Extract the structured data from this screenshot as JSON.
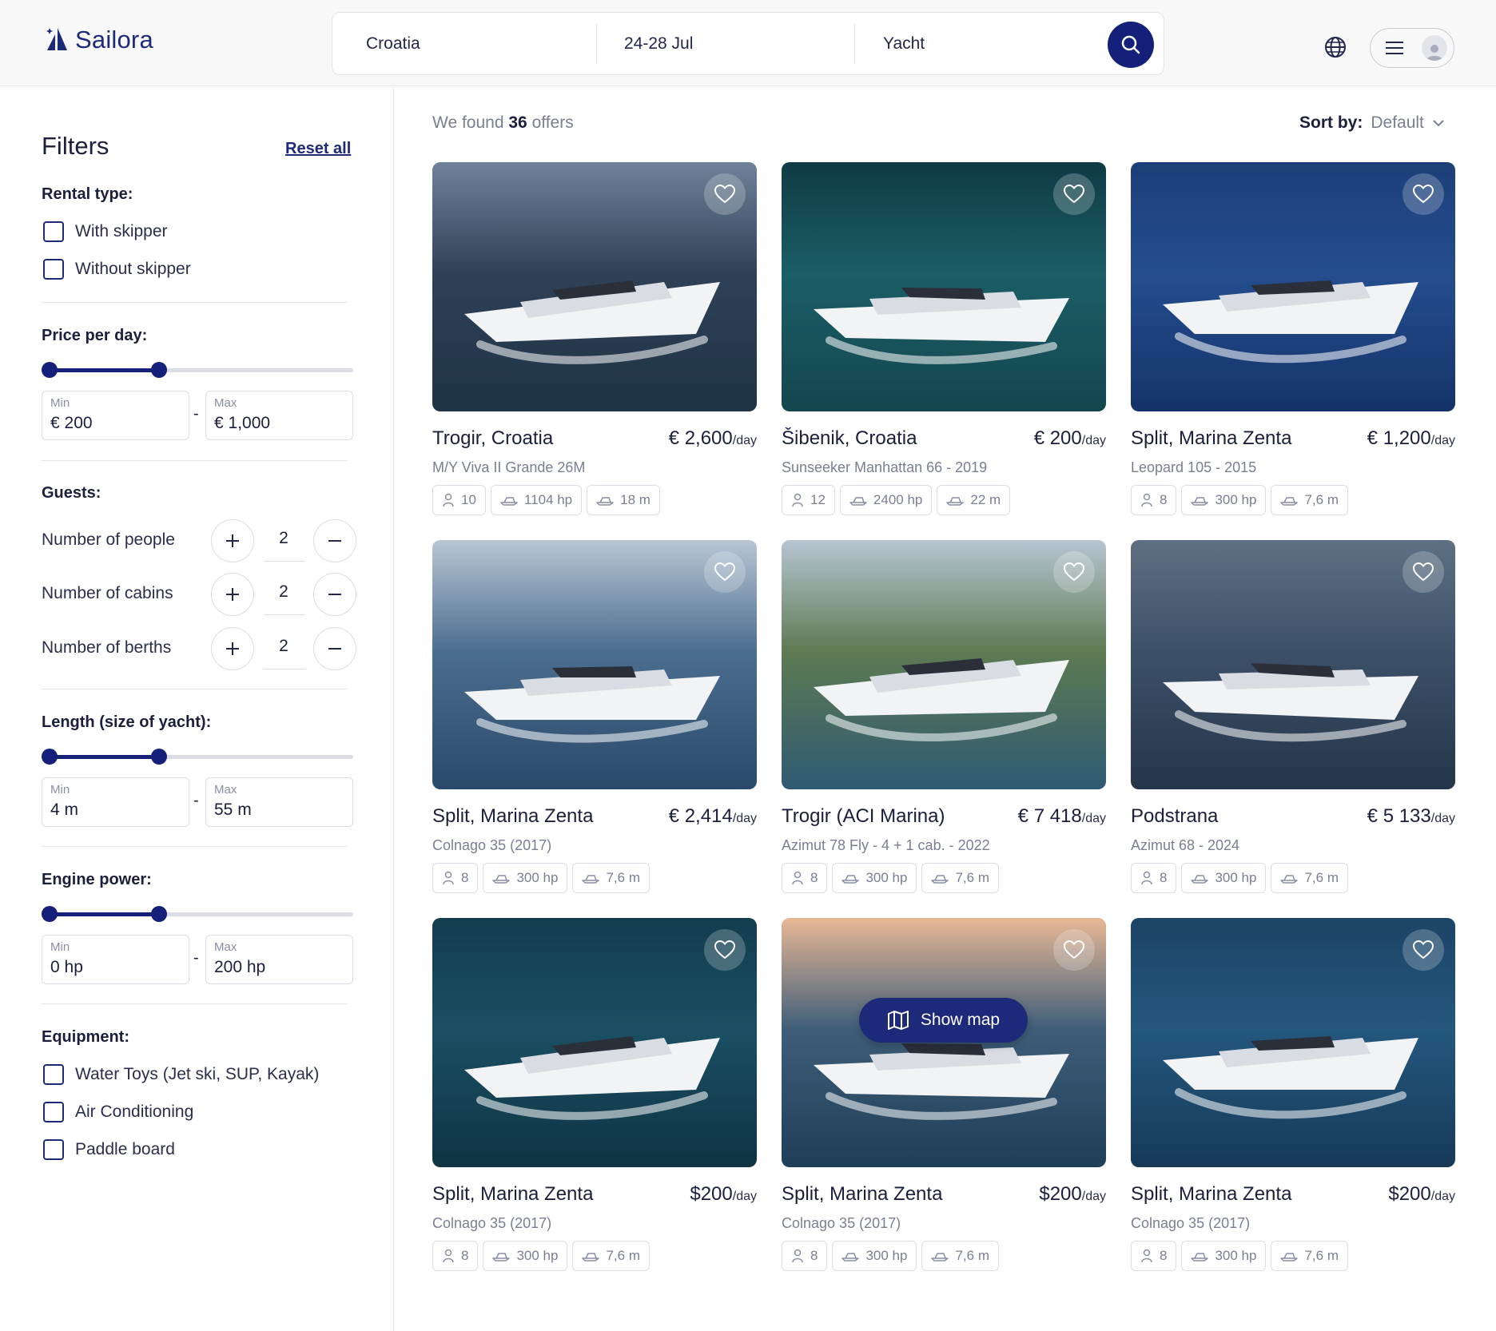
{
  "brand": {
    "name": "Sailora",
    "color": "#1d2a7a"
  },
  "search": {
    "location": "Croatia",
    "dates": "24-28 Jul",
    "boat_type": "Yacht",
    "button_icon": "search-icon"
  },
  "header": {
    "globe_icon": "globe-icon",
    "menu_icon": "hamburger-icon",
    "avatar_icon": "user-icon"
  },
  "filters": {
    "title": "Filters",
    "reset_label": "Reset all",
    "rental_type": {
      "label": "Rental type:",
      "options": [
        "With skipper",
        "Without skipper"
      ]
    },
    "price": {
      "label": "Price per day:",
      "min_label": "Min",
      "min_value": "€ 200",
      "max_label": "Max",
      "max_value": "€ 1,000",
      "range_fraction": [
        0,
        0.36
      ]
    },
    "guests": {
      "label": "Guests:",
      "rows": [
        {
          "label": "Number of people",
          "value": "2"
        },
        {
          "label": "Number of cabins",
          "value": "2"
        },
        {
          "label": "Number of berths",
          "value": "2"
        }
      ]
    },
    "length": {
      "label": "Length (size of yacht):",
      "min_label": "Min",
      "min_value": "4 m",
      "max_label": "Max",
      "max_value": "55 m",
      "range_fraction": [
        0,
        0.36
      ]
    },
    "engine": {
      "label": "Engine power:",
      "min_label": "Min",
      "min_value": "0 hp",
      "max_label": "Max",
      "max_value": "200 hp",
      "range_fraction": [
        0,
        0.36
      ]
    },
    "equipment": {
      "label": "Equipment:",
      "options": [
        "Water Toys (Jet ski, SUP, Kayak)",
        "Air Conditioning",
        "Paddle board"
      ]
    }
  },
  "results": {
    "prefix": "We found",
    "count": "36",
    "suffix": "offers",
    "sort_label": "Sort by:",
    "sort_value": "Default"
  },
  "per_day": "/day",
  "listings": [
    {
      "location": "Trogir, Croatia",
      "price": "€ 2,600",
      "model": "M/Y Viva II Grande 26M",
      "guests": "10",
      "power": "1104 hp",
      "length": "18 m"
    },
    {
      "location": "Šibenik, Croatia",
      "price": "€ 200",
      "model": "Sunseeker Manhattan 66 - 2019",
      "guests": "12",
      "power": "2400 hp",
      "length": "22 m"
    },
    {
      "location": "Split, Marina Zenta",
      "price": "€ 1,200",
      "model": "Leopard 105 - 2015",
      "guests": "8",
      "power": "300 hp",
      "length": "7,6 m"
    },
    {
      "location": "Split, Marina Zenta",
      "price": "€ 2,414",
      "model": "Colnago 35 (2017)",
      "guests": "8",
      "power": "300 hp",
      "length": "7,6 m"
    },
    {
      "location": "Trogir (ACI Marina)",
      "price": "€ 7 418",
      "model": "Azimut 78 Fly - 4 + 1 cab. - 2022",
      "guests": "8",
      "power": "300 hp",
      "length": "7,6 m"
    },
    {
      "location": "Podstrana",
      "price": "€ 5 133",
      "model": "Azimut 68 - 2024",
      "guests": "8",
      "power": "300 hp",
      "length": "7,6 m"
    },
    {
      "location": "Split, Marina Zenta",
      "price": "$200",
      "model": "Colnago 35 (2017)",
      "guests": "8",
      "power": "300 hp",
      "length": "7,6 m"
    },
    {
      "location": "Split, Marina Zenta",
      "price": "$200",
      "model": "Colnago 35 (2017)",
      "guests": "8",
      "power": "300 hp",
      "length": "7,6 m"
    },
    {
      "location": "Split, Marina Zenta",
      "price": "$200",
      "model": "Colnago 35 (2017)",
      "guests": "8",
      "power": "300 hp",
      "length": "7,6 m"
    }
  ],
  "map_button": {
    "label": "Show map",
    "icon": "map-icon"
  },
  "colors": {
    "primary": "#14207a",
    "muted_text": "#7a7e93",
    "border": "#dcdde4"
  }
}
